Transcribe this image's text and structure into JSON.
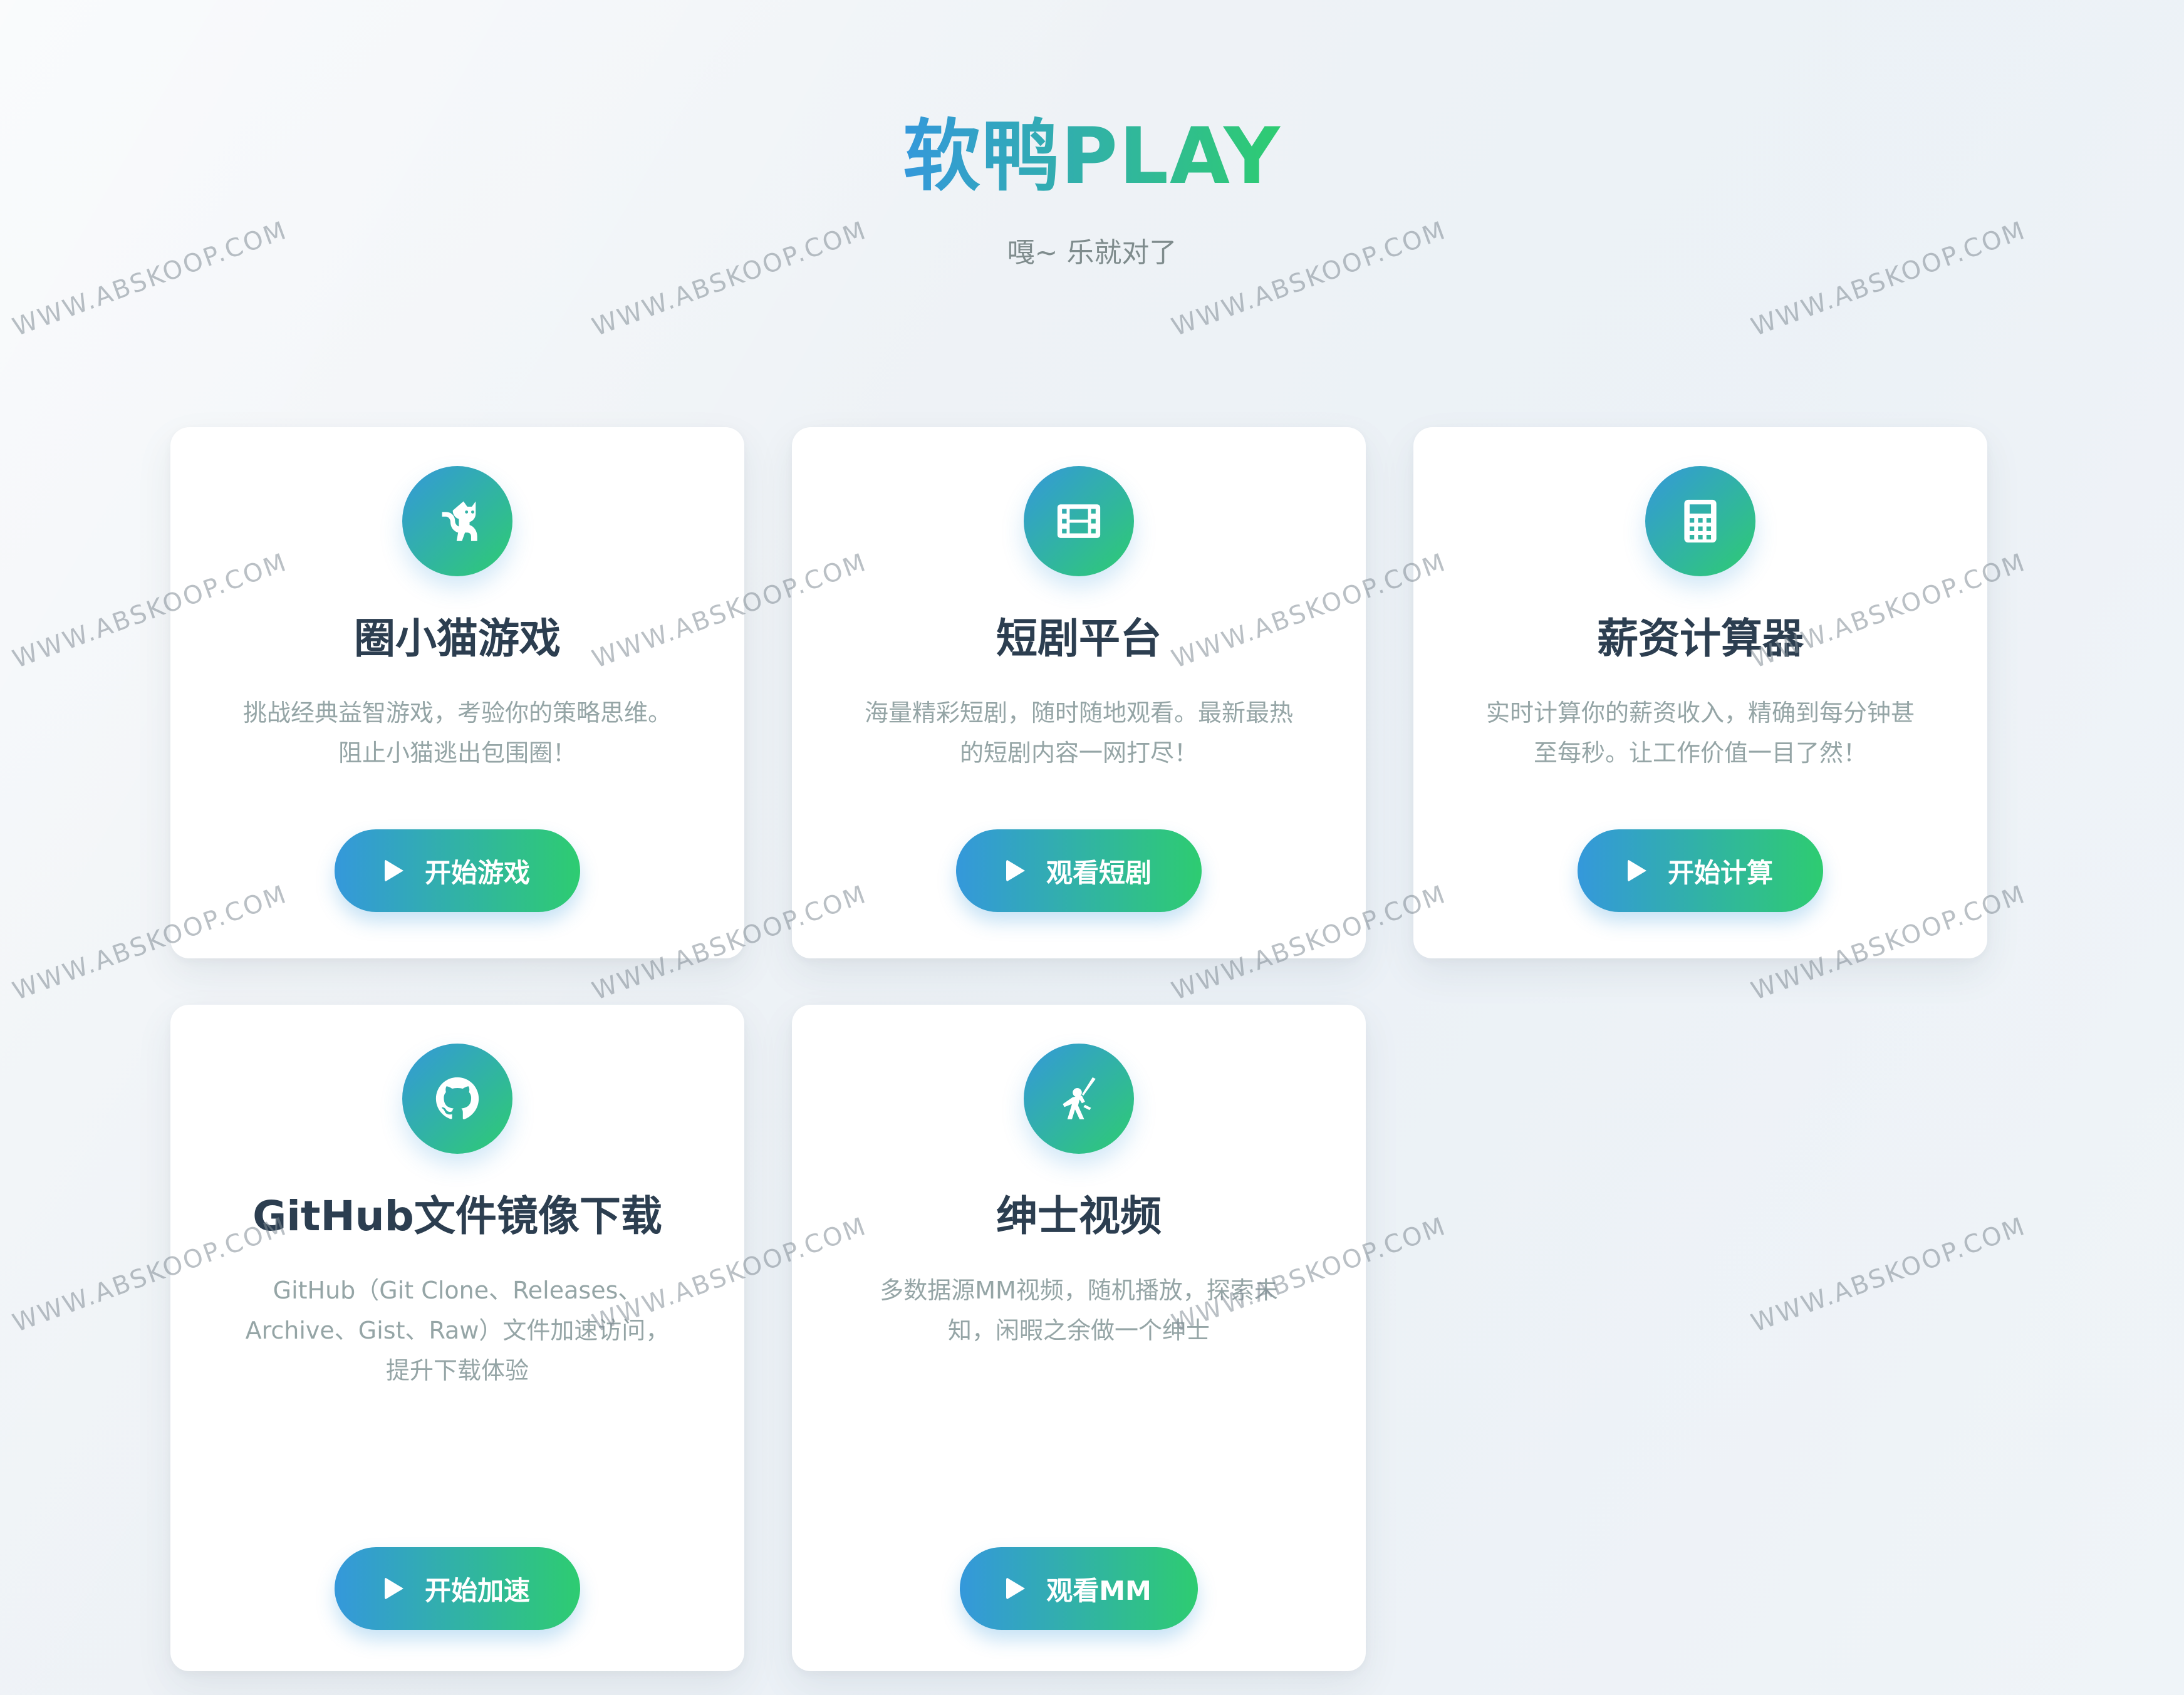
{
  "header": {
    "title": "软鸭PLAY",
    "subtitle": "嘎~ 乐就对了"
  },
  "cards": [
    {
      "icon": "cat-icon",
      "title": "圈小猫游戏",
      "description": "挑战经典益智游戏，考验你的策略思维。阻止小猫逃出包围圈！",
      "button": "开始游戏"
    },
    {
      "icon": "film-icon",
      "title": "短剧平台",
      "description": "海量精彩短剧，随时随地观看。最新最热的短剧内容一网打尽！",
      "button": "观看短剧"
    },
    {
      "icon": "calculator-icon",
      "title": "薪资计算器",
      "description": "实时计算你的薪资收入，精确到每分钟甚至每秒。让工作价值一目了然！",
      "button": "开始计算"
    },
    {
      "icon": "github-icon",
      "title": "GitHub文件镜像下载",
      "description": "GitHub（Git Clone、Releases、Archive、Gist、Raw）文件加速访问，提升下载体验",
      "button": "开始加速"
    },
    {
      "icon": "ninja-icon",
      "title": "绅士视频",
      "description": "多数据源MM视频，随机播放，探索未知，闲暇之余做一个绅士",
      "button": "观看MM"
    }
  ],
  "watermark": "WWW.ABSKOOP.COM",
  "colors": {
    "gradient_start": "#3498db",
    "gradient_end": "#2ecc71",
    "title_text": "#2c3e50",
    "desc_text": "#95a5a6"
  }
}
